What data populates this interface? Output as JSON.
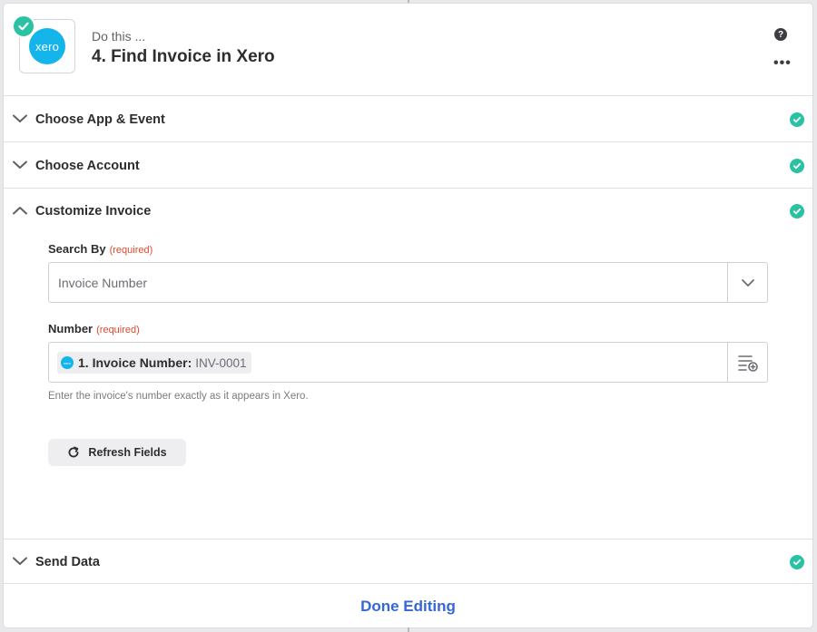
{
  "header": {
    "subtitle": "Do this ...",
    "title": "4. Find Invoice in Xero",
    "app_logo_text": "xero",
    "help_glyph": "?",
    "more_glyph": "•••"
  },
  "sections": [
    {
      "title": "Choose App & Event",
      "state": "collapsed",
      "complete": true
    },
    {
      "title": "Choose Account",
      "state": "collapsed",
      "complete": true
    },
    {
      "title": "Customize Invoice",
      "state": "expanded",
      "complete": true
    },
    {
      "title": "Send Data",
      "state": "collapsed",
      "complete": true
    }
  ],
  "form": {
    "search_by": {
      "label": "Search By",
      "required_text": "(required)",
      "value": "Invoice Number"
    },
    "number": {
      "label": "Number",
      "required_text": "(required)",
      "pill_logo_text": "xero",
      "pill_key": "1. Invoice Number:",
      "pill_value": "INV-0001",
      "help": "Enter the invoice's number exactly as it appears in Xero."
    },
    "refresh_label": "Refresh Fields"
  },
  "footer": {
    "done_label": "Done Editing"
  },
  "colors": {
    "success": "#2ac2a3",
    "xero_brand": "#13b5ea",
    "required": "#e0482d",
    "link": "#3567d6"
  },
  "icons": {
    "status": "check-circle-icon",
    "help": "help-circle-icon",
    "more": "more-horizontal-icon",
    "chevron_down": "chevron-down-icon",
    "chevron_up": "chevron-up-icon",
    "insert_data": "insert-data-icon",
    "refresh": "refresh-icon"
  }
}
